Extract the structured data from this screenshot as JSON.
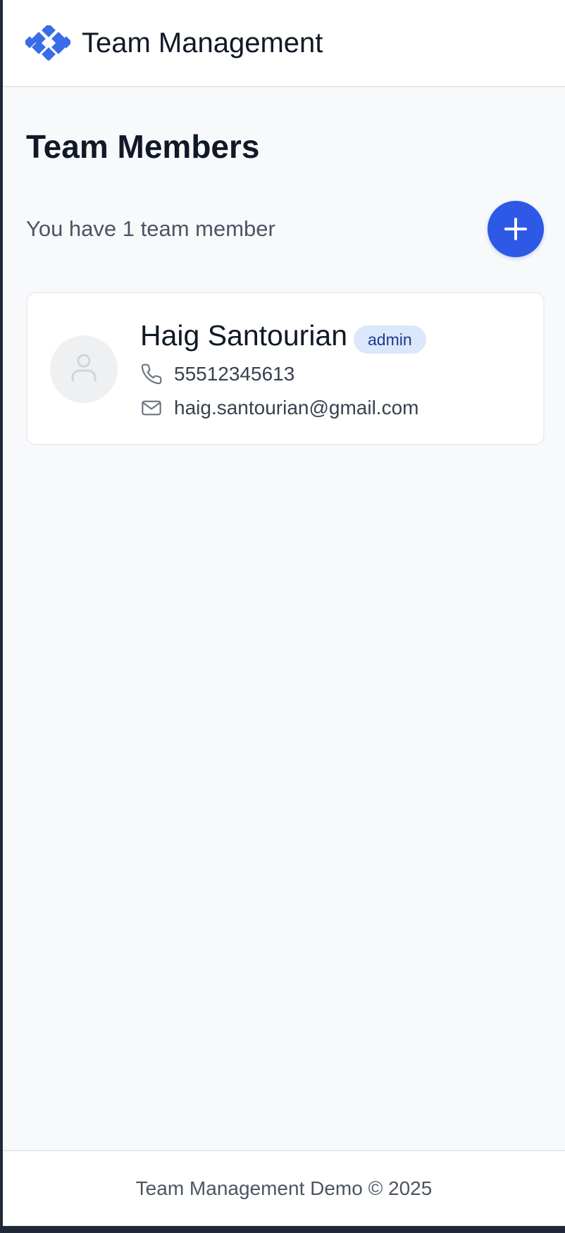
{
  "header": {
    "app_title": "Team Management",
    "logo_icon": "diamond-grid-logo-icon"
  },
  "main": {
    "page_title": "Team Members",
    "member_count_text": "You have 1 team member",
    "add_button_icon": "plus-icon"
  },
  "members": [
    {
      "name": "Haig Santourian",
      "role": "admin",
      "phone": "55512345613",
      "email": "haig.santourian@gmail.com",
      "avatar_icon": "user-icon",
      "phone_icon": "phone-icon",
      "email_icon": "mail-icon"
    }
  ],
  "footer": {
    "text": "Team Management Demo © 2025"
  },
  "colors": {
    "accent": "#2d59e6",
    "logo": "#3a6be8",
    "badge_bg": "#dbe7fb",
    "badge_text": "#1e3a8a",
    "page_bg": "#f8f9fb"
  }
}
